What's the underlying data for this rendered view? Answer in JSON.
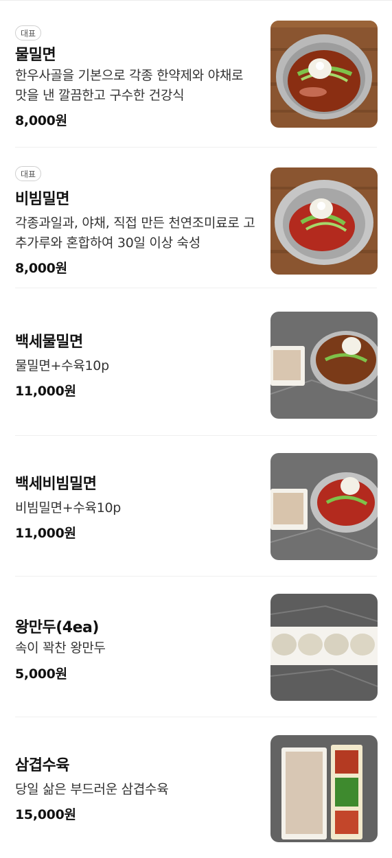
{
  "menu": {
    "items": [
      {
        "badge": "대표",
        "name": "물밀면",
        "description": "한우사골을 기본으로 각종 한약제와 야채로 맛을 낸 깔끔한고 구수한 건강식",
        "price": "8,000원",
        "photo_icon": "mul-milmyeon-photo"
      },
      {
        "badge": "대표",
        "name": "비빔밀면",
        "description": "각종과일과, 야채, 직접 만든 천연조미료로 고추가루와 혼합하여 30일 이상 숙성",
        "price": "8,000원",
        "photo_icon": "bibim-milmyeon-photo"
      },
      {
        "name": "백세물밀면",
        "description": "물밀면+수육10p",
        "price": "11,000원",
        "photo_icon": "baekse-mul-milmyeon-photo"
      },
      {
        "name": "백세비빔밀면",
        "description": "비빔밀면+수육10p",
        "price": "11,000원",
        "photo_icon": "baekse-bibim-milmyeon-photo"
      },
      {
        "name": "왕만두(4ea)",
        "description": "속이 꽉찬 왕만두",
        "price": "5,000원",
        "photo_icon": "wang-mandu-photo"
      },
      {
        "name": "삼겹수육",
        "description": "당일 삶은 부드러운 삼겹수육",
        "price": "15,000원",
        "photo_icon": "samgyeop-suyuk-photo"
      }
    ]
  },
  "colors": {
    "text": "#111111",
    "divider": "#efefef",
    "badge_border": "#cfcfcf",
    "wood": "#8a5530",
    "stone": "#6e6e6e"
  }
}
